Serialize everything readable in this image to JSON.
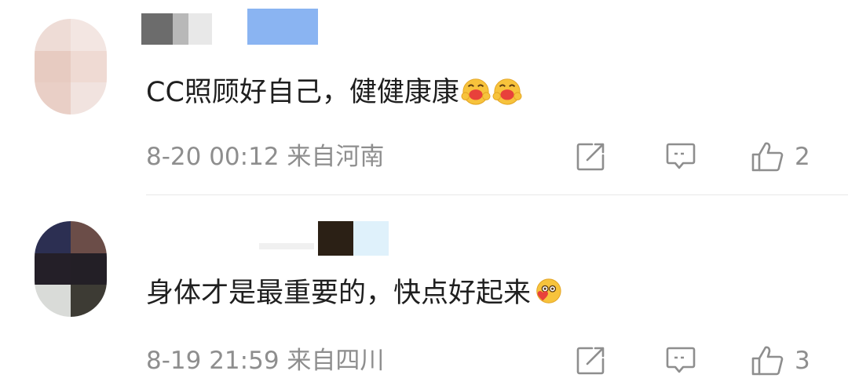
{
  "comments": [
    {
      "text": "CC照顾好自己，健健康康",
      "emojis": [
        "hug-emoji",
        "hug-emoji"
      ],
      "time": "8-20 00:12",
      "location": "来自河南",
      "likes": "2"
    },
    {
      "text": "身体才是最重要的，快点好起来",
      "emojis": [
        "heart-hug-emoji"
      ],
      "time": "8-19 21:59",
      "location": "来自四川",
      "likes": "3"
    }
  ],
  "colors": {
    "text_primary": "#1f1f1f",
    "text_secondary": "#8e8e8e",
    "icon_gray": "#8e8e8e",
    "divider": "#e8e8e8",
    "emoji_yellow": "#f7c33c",
    "emoji_red": "#e8413b"
  },
  "icons": {
    "share": "share-icon",
    "comment": "comment-icon",
    "like": "thumbs-up-icon"
  }
}
